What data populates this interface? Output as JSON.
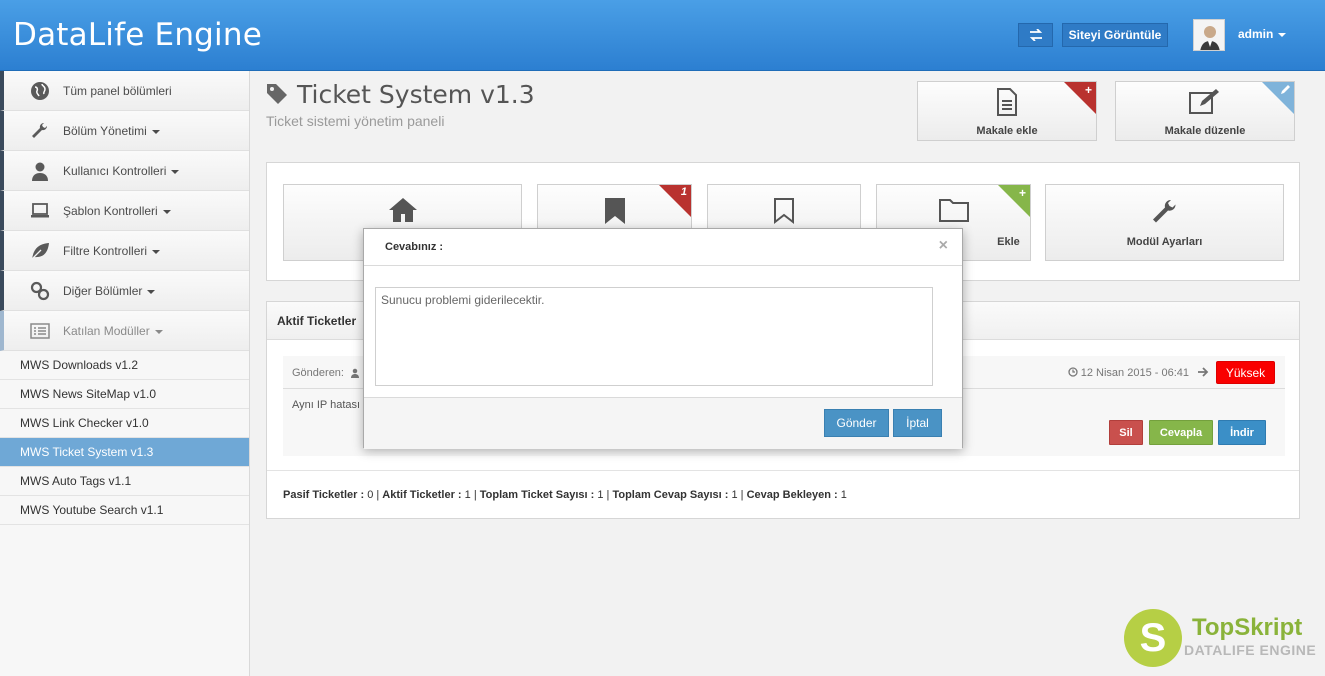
{
  "header": {
    "brand": "DataLife Engine",
    "swap_icon": "swap-icon",
    "view_site_label": "Siteyi Görüntüle",
    "user_name": "admin"
  },
  "sidebar": {
    "items": [
      {
        "label": "Tüm panel bölümleri",
        "icon": "globe-icon"
      },
      {
        "label": "Bölüm Yönetimi",
        "icon": "wrench-icon"
      },
      {
        "label": "Kullanıcı Kontrolleri",
        "icon": "user-icon"
      },
      {
        "label": "Şablon Kontrolleri",
        "icon": "laptop-icon"
      },
      {
        "label": "Filtre Kontrolleri",
        "icon": "leaf-icon"
      },
      {
        "label": "Diğer Bölümler",
        "icon": "link-icon"
      },
      {
        "label": "Katılan Modüller",
        "icon": "list-icon"
      }
    ],
    "submodules": [
      "MWS Downloads v1.2",
      "MWS News SiteMap v1.0",
      "MWS Link Checker v1.0",
      "MWS Ticket System v1.3",
      "MWS Auto Tags v1.1",
      "MWS Youtube Search v1.1"
    ],
    "active_submodule": "MWS Ticket System v1.3"
  },
  "page": {
    "title": "Ticket System v1.3",
    "subtitle": "Ticket sistemi yönetim paneli"
  },
  "quick_actions": {
    "add_article": "Makale ekle",
    "edit_article": "Makale düzenle"
  },
  "tiles": {
    "badge_count": "1",
    "category_add_label": "Ekle",
    "module_settings_label": "Modül Ayarları"
  },
  "active_tickets": {
    "heading": "Aktif Ticketler",
    "sender_label": "Gönderen:",
    "description": "Aynı IP hatası",
    "date": "12 Nisan 2015 - 06:41",
    "priority": "Yüksek",
    "priority_color": "#f90000",
    "actions": {
      "delete": "Sil",
      "reply": "Cevapla",
      "download": "İndir"
    }
  },
  "stats": {
    "passive_label": "Pasif Ticketler :",
    "passive_value": "0",
    "active_label": "Aktif Ticketler :",
    "active_value": "1",
    "total_label": "Toplam Ticket Sayısı :",
    "total_value": "1",
    "replies_label": "Toplam Cevap Sayısı :",
    "replies_value": "1",
    "pending_label": "Cevap Bekleyen :",
    "pending_value": "1"
  },
  "modal": {
    "title": "Cevabınız :",
    "text": "Sunucu problemi giderilecektir.",
    "send": "Gönder",
    "cancel": "İptal"
  },
  "watermark": {
    "letter": "S",
    "line1": "TopSkript",
    "line2": "DATALIFE ENGINE"
  }
}
